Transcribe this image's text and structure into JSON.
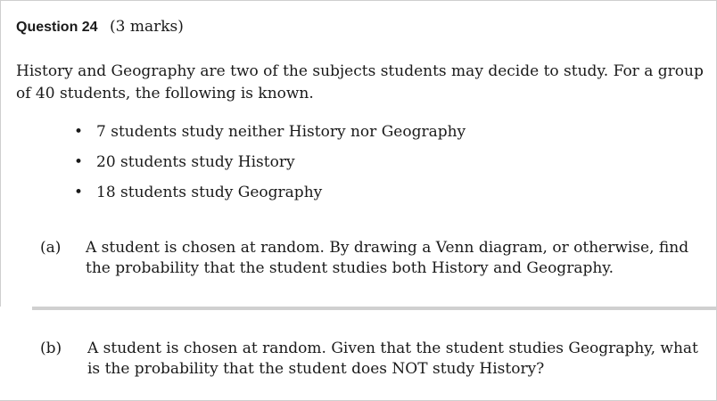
{
  "question": {
    "label": "Question 24",
    "marks": "(3 marks)"
  },
  "intro": "History and Geography are two of the subjects students may decide to study. For a group of 40 students, the following is known.",
  "facts": [
    "7 students study neither History nor Geography",
    "20 students study History",
    "18 students study Geography"
  ],
  "bullet_glyph": "•",
  "parts": {
    "a": {
      "label": "(a)",
      "text": "A student is chosen at random. By drawing a Venn diagram, or otherwise, find the probability that the student studies both History and Geography."
    },
    "b": {
      "label": "(b)",
      "text": "A student is chosen at random. Given that the student studies Geography, what is the probability that the student does NOT study History?"
    }
  }
}
